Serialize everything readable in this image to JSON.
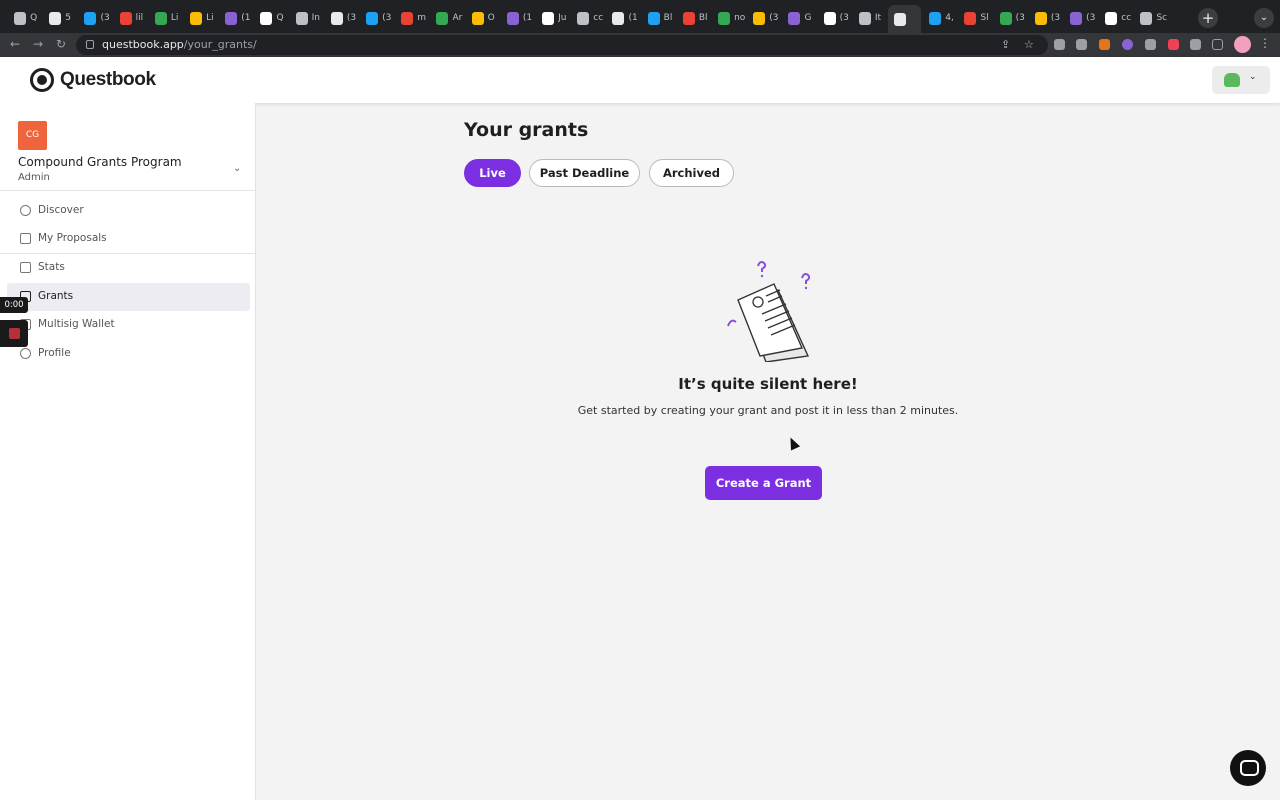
{
  "browser": {
    "url_host": "questbook.app",
    "url_path": "/your_grants/",
    "tabs": [
      "Q",
      "5",
      "(3",
      "lil",
      "Li",
      "Li",
      "(1",
      "Q",
      "In",
      "(3",
      "(3",
      "m",
      "Ar",
      "O",
      "(1",
      "Ju",
      "cc",
      "(1",
      "Bl",
      "Bl",
      "no",
      "(3",
      "G",
      "(3",
      "It",
      "",
      "4,",
      "Sl",
      "(3",
      "(3",
      "(3",
      "cc",
      "Sc"
    ]
  },
  "app": {
    "logo_text": "Questbook"
  },
  "sidebar": {
    "org_initials": "CG",
    "org_name": "Compound Grants Program",
    "org_role": "Admin",
    "items": [
      {
        "label": "Discover",
        "icon": "compass-icon"
      },
      {
        "label": "My Proposals",
        "icon": "document-icon"
      },
      {
        "label": "Stats",
        "icon": "stats-icon"
      },
      {
        "label": "Grants",
        "icon": "layers-icon"
      },
      {
        "label": "Multisig Wallet",
        "icon": "wallet-icon"
      },
      {
        "label": "Profile",
        "icon": "gear-icon"
      }
    ],
    "active_item": "Grants"
  },
  "recording": {
    "timer": "0:00"
  },
  "main": {
    "title": "Your grants",
    "tabs": [
      {
        "label": "Live",
        "active": true
      },
      {
        "label": "Past Deadline",
        "active": false
      },
      {
        "label": "Archived",
        "active": false
      }
    ],
    "empty_state": {
      "title": "It’s quite silent here!",
      "subtitle": "Get started by creating your grant and post it in less than 2 minutes.",
      "cta_label": "Create a Grant"
    }
  },
  "colors": {
    "accent": "#7b2fe0",
    "org_avatar": "#f0643c"
  }
}
